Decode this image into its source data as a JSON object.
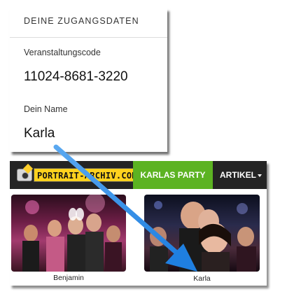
{
  "login_card": {
    "title": "DEINE ZUGANGSDATEN",
    "event_code_label": "Veranstaltungscode",
    "event_code_value": "11024-8681-3220",
    "name_label": "Dein Name",
    "name_value": "Karla"
  },
  "site": {
    "logo_text": "PORTRAIT-ARCHIV.COM",
    "nav_party": "KARLAS PARTY",
    "nav_artikel": "ARTIKEL",
    "accent_color": "#5cb322",
    "photos": [
      {
        "caption": "Benjamin"
      },
      {
        "caption": "Karla"
      }
    ]
  },
  "arrow_color": "#2f8fe8"
}
